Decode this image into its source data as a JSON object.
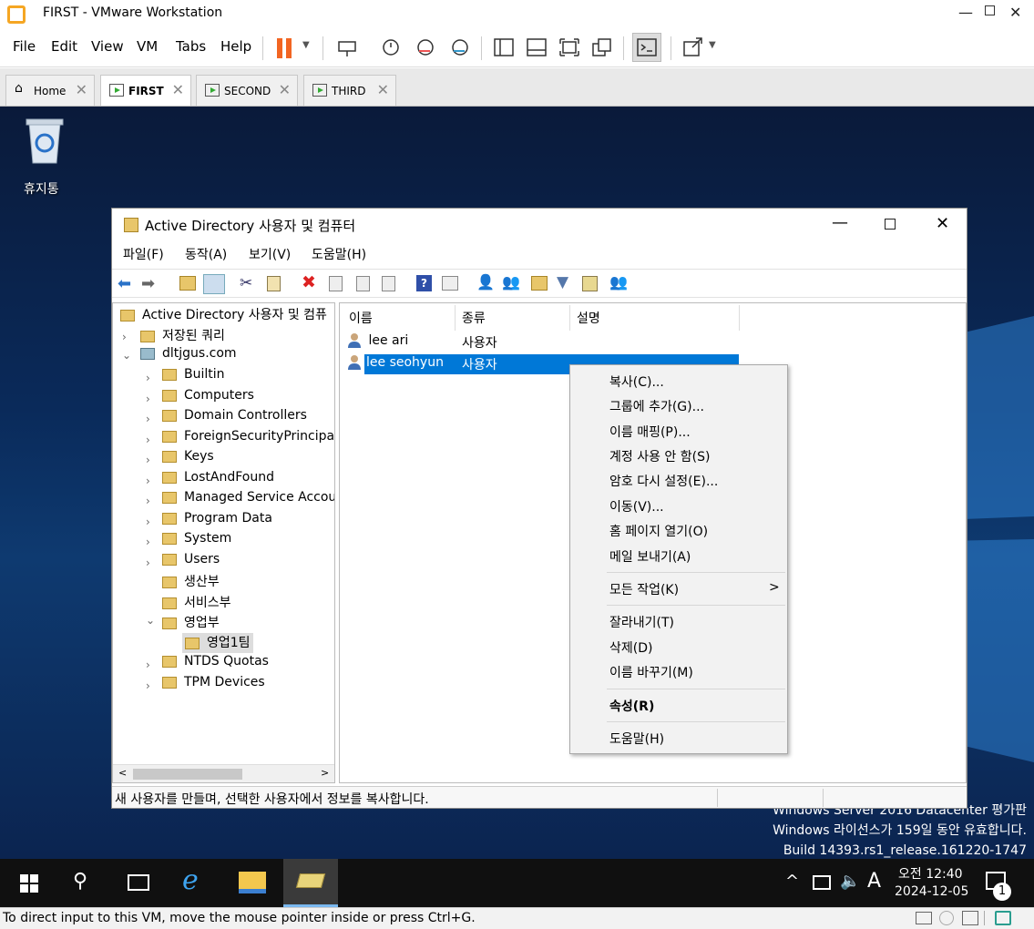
{
  "app": {
    "title": "FIRST - VMware Workstation"
  },
  "menu": [
    "File",
    "Edit",
    "View",
    "VM",
    "Tabs",
    "Help"
  ],
  "tabs": [
    {
      "label": "Home"
    },
    {
      "label": "FIRST"
    },
    {
      "label": "SECOND"
    },
    {
      "label": "THIRD"
    }
  ],
  "desktop": {
    "recycle_label": "휴지통",
    "watermark": [
      "Windows Server 2016 Datacenter 평가판",
      "Windows 라이선스가 159일 동안 유효합니다.",
      "Build 14393.rs1_release.161220-1747"
    ]
  },
  "ad": {
    "title": "Active Directory 사용자 및 컴퓨터",
    "menu": [
      "파일(F)",
      "동작(A)",
      "보기(V)",
      "도움말(H)"
    ],
    "tree": {
      "root": "Active Directory 사용자 및 컴퓨",
      "saved": "저장된 쿼리",
      "domain": "dltjgus.com",
      "items": [
        "Builtin",
        "Computers",
        "Domain Controllers",
        "ForeignSecurityPrincipal",
        "Keys",
        "LostAndFound",
        "Managed Service Accou",
        "Program Data",
        "System",
        "Users",
        "생산부",
        "서비스부",
        "영업부",
        "영업1팀",
        "NTDS Quotas",
        "TPM Devices"
      ]
    },
    "list": {
      "headers": [
        "이름",
        "종류",
        "설명"
      ],
      "rows": [
        {
          "name": "lee ari",
          "type": "사용자"
        },
        {
          "name": "lee seohyun",
          "type": "사용자"
        }
      ]
    },
    "status": "새 사용자를 만들며, 선택한 사용자에서 정보를 복사합니다."
  },
  "context_menu": {
    "items": [
      "복사(C)...",
      "그룹에 추가(G)...",
      "이름 매핑(P)...",
      "계정 사용 안 함(S)",
      "암호 다시 설정(E)...",
      "이동(V)...",
      "홈 페이지 열기(O)",
      "메일 보내기(A)",
      "모든 작업(K)",
      "잘라내기(T)",
      "삭제(D)",
      "이름 바꾸기(M)",
      "속성(R)",
      "도움말(H)"
    ],
    "submenu_arrow": ">"
  },
  "taskbar": {
    "time": "오전 12:40",
    "date": "2024-12-05",
    "ime": "A",
    "notif_count": "1"
  },
  "vm_status": "To direct input to this VM, move the mouse pointer inside or press Ctrl+G.",
  "colors": {
    "selection": "#0078d7",
    "desktop": "#0a2a5a"
  }
}
